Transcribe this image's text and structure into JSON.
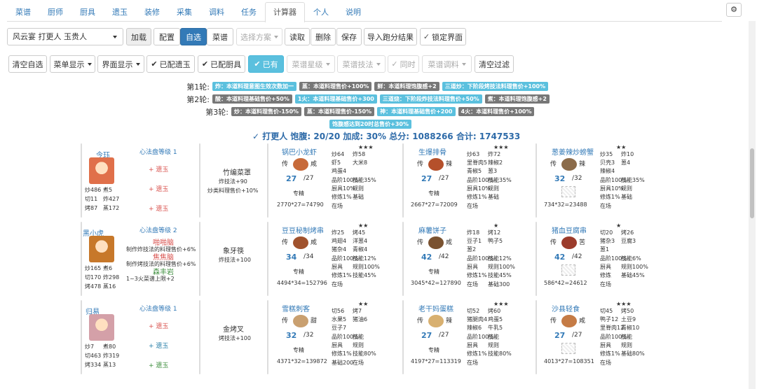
{
  "tabs": [
    "菜谱",
    "厨师",
    "厨具",
    "遗玉",
    "装修",
    "采集",
    "调料",
    "任务",
    "计算器",
    "个人",
    "说明"
  ],
  "toolbar1": {
    "select": "风云宴 打更人 玉贵人",
    "load": "加载",
    "config": "配置",
    "self": "自选",
    "recipe": "菜谱",
    "scheme": "选择方案",
    "read": "读取",
    "delete": "删除",
    "save": "保存",
    "import": "导入跑分结果",
    "lock": "锁定界面"
  },
  "toolbar2": {
    "clear_self": "清空自选",
    "menu_show": "菜单显示",
    "ui_show": "界面显示",
    "yiyu": "已配遗玉",
    "chuju": "已配厨具",
    "yiyou": "已有",
    "star": "菜谱星级",
    "skill": "菜谱技法",
    "same": "同时",
    "season": "菜谱调料",
    "clear_filter": "清空过滤"
  },
  "rounds": [
    {
      "label": "第1轮:",
      "badges": [
        {
          "text": "炸：本道料理意图生效次数加一",
          "c": "bi"
        },
        {
          "text": "蒸：本道料理售价+100%",
          "c": "bg"
        },
        {
          "text": "鲜：本道料理饱腹感+2",
          "c": "bg"
        },
        {
          "text": "三道炒：下阶段烤技法料理售价+100%",
          "c": "bi"
        }
      ]
    },
    {
      "label": "第2轮:",
      "badges": [
        {
          "text": "酸：本道料理基础售价+50%",
          "c": "bg"
        },
        {
          "text": "1火：本道料理基础售价+300",
          "c": "bi"
        },
        {
          "text": "三道烧：下阶段炸技法料理售价+50%",
          "c": "bi"
        },
        {
          "text": "煮：本道料理饱腹感+2",
          "c": "bg"
        }
      ]
    },
    {
      "label": "第3轮:",
      "badges": [
        {
          "text": "炒：本道料理售价-150%",
          "c": "bg"
        },
        {
          "text": "蒸：本道料理售价-150%",
          "c": "bg"
        },
        {
          "text": "神：本道料理基础售价+200",
          "c": "bi"
        },
        {
          "text": "4火：本道料理售价+100%",
          "c": "bg"
        }
      ]
    },
    {
      "label": "",
      "badges": [
        {
          "text": "饱腹感达到20时总售价+30%",
          "c": "bi"
        }
      ]
    }
  ],
  "summary": "✓ 打更人 饱腹: 20/20 加成: 30% 总分: 1088266 合计: 1747533",
  "chefs": [
    {
      "name": "今珏",
      "level": "心法盘等级 1",
      "stats": [
        "炒486",
        "煮5",
        "切11",
        "炸427",
        "烤87",
        "蒸172"
      ],
      "gems": [
        {
          "t": "+ 遗玉",
          "c": "red"
        },
        {
          "t": "+ 遗玉",
          "c": "red"
        },
        {
          "t": "+ 遗玉",
          "c": "red"
        }
      ],
      "avatar": "#e0704a",
      "tool": {
        "name": "竹编菜罩",
        "l1": "炸技法+90",
        "l2": "炒类料理售价+10%"
      },
      "dishes": [
        {
          "name": "锅巴小龙虾",
          "stars": "★★★",
          "q": "传",
          "cond": "咸",
          "cnt": "27",
          "max": "/27",
          "label": "专精",
          "calc": "2770*27=74790",
          "mat": [
            "炒64",
            "炸58",
            "虾5",
            "大米8",
            "鸡蛋4",
            ""
          ],
          "eff": [
            "品阶100%",
            "技能35%",
            "厨具10%",
            "规则",
            "修炼1%",
            "基础"
          ],
          "place": "在场",
          "img": "#c76a3a"
        },
        {
          "name": "生爆排骨",
          "stars": "★★★",
          "q": "传",
          "cond": "辣",
          "cnt": "27",
          "max": "/27",
          "label": "专精",
          "calc": "2667*27=72009",
          "mat": [
            "炒63",
            "炸72",
            "里脊肉5",
            "辣椒2",
            "青椒5",
            "葱3"
          ],
          "eff": [
            "品阶100%",
            "技能35%",
            "厨具10%",
            "规则",
            "修炼1%",
            "基础"
          ],
          "place": "在场",
          "img": "#b5502b"
        },
        {
          "name": "葱姜辣炒螃蟹",
          "stars": "★★",
          "q": "传",
          "cond": "辣",
          "cnt": "32",
          "max": "/32",
          "label": "",
          "calc": "734*32=23488",
          "mat": [
            "炒35",
            "炸10",
            "贝壳3",
            "葱4",
            "辣椒4",
            ""
          ],
          "eff": [
            "品阶100%",
            "技能35%",
            "厨具10%",
            "规则",
            "修炼1%",
            "基础"
          ],
          "place": "在场",
          "img": "#8b6b4a",
          "ph": true
        }
      ]
    },
    {
      "name": "黑小虎",
      "level": "心法盘等级 2",
      "stats": [
        "炒165",
        "煮6",
        "切170",
        "炸298",
        "烤478",
        "蒸16"
      ],
      "gems": [
        {
          "t": "啪啪脑",
          "c": "red",
          "sub": "制作炸技法的料理售价+6%"
        },
        {
          "t": "焦焦脑",
          "c": "red",
          "sub": "制作烤技法的料理售价+6%"
        },
        {
          "t": "森丰岩",
          "c": "green",
          "sub": "1~3火菜谱上限+2"
        }
      ],
      "avatar": "#c7782a",
      "tool": {
        "name": "象牙筷",
        "l1": "炸技法+100",
        "l2": ""
      },
      "dishes": [
        {
          "name": "豆豆秘制烤串",
          "stars": "★★",
          "q": "传",
          "cond": "咸",
          "cnt": "34",
          "max": "/34",
          "label": "专精",
          "calc": "4494*34=152796",
          "mat": [
            "炸25",
            "烤45",
            "鸡翅4",
            "洋葱4",
            "猪杂4",
            "青椒4"
          ],
          "eff": [
            "品阶100%",
            "技能12%",
            "厨具",
            "规则100%",
            "修炼1%",
            "技能45%"
          ],
          "place": "在场",
          "img": "#a0522d"
        },
        {
          "name": "麻薯饼子",
          "stars": "★",
          "q": "传",
          "cond": "咸",
          "cnt": "42",
          "max": "/42",
          "label": "专精",
          "calc": "3045*42=127890",
          "mat": [
            "炸18",
            "烤12",
            "豆子1",
            "鸭子5",
            "葱2",
            ""
          ],
          "eff": [
            "品阶100%",
            "技能12%",
            "厨具",
            "规则100%",
            "修炼1%",
            "技能45%"
          ],
          "place": "在场",
          "extra": "基础300",
          "img": "#7a5230"
        },
        {
          "name": "猪血豆腐串",
          "stars": "★",
          "q": "传",
          "cond": "苦",
          "cnt": "42",
          "max": "/42",
          "label": "",
          "calc": "586*42=24612",
          "mat": [
            "切20",
            "烤26",
            "猪杂3",
            "豆腐3",
            "葱1",
            ""
          ],
          "eff": [
            "品阶100%",
            "技能6%",
            "厨具",
            "规则100%",
            "修炼",
            "基础45%"
          ],
          "place": "在场",
          "img": "#9b3b2b",
          "ph": true
        }
      ]
    },
    {
      "name": "归易",
      "level": "心法盘等级 1",
      "stats": [
        "炒7",
        "煮80",
        "切463",
        "炸319",
        "烤334",
        "蒸13"
      ],
      "gems": [
        {
          "t": "+ 遗玉",
          "c": "red"
        },
        {
          "t": "+ 遗玉",
          "c": "teal"
        },
        {
          "t": "+ 遗玉",
          "c": "green"
        }
      ],
      "avatar": "#d4a0a8",
      "tool": {
        "name": "金烤叉",
        "l1": "烤技法+100",
        "l2": ""
      },
      "dishes": [
        {
          "name": "雪糕刺客",
          "stars": "★★",
          "q": "传",
          "cond": "甜",
          "cnt": "32",
          "max": "/32",
          "label": "专精",
          "calc": "4371*32=139872",
          "mat": [
            "切56",
            "烤7",
            "水果5",
            "猪油6",
            "豆子7",
            ""
          ],
          "eff": [
            "品阶100%",
            "技能",
            "厨具",
            "规则",
            "修炼1%",
            "技能80%"
          ],
          "place": "基础200",
          "extra": "在场",
          "img": "#c9a070"
        },
        {
          "name": "老干妈蛋糕",
          "stars": "★★★",
          "q": "传",
          "cond": "辣",
          "cnt": "27",
          "max": "/27",
          "label": "专精",
          "calc": "4197*27=113319",
          "mat": [
            "切52",
            "烤60",
            "猪腿肉4",
            "鸡蛋5",
            "辣椒6",
            "牛乳5"
          ],
          "eff": [
            "品阶100%",
            "技能",
            "厨具",
            "规则",
            "修炼1%",
            "技能80%"
          ],
          "place": "在场",
          "img": "#d8b070"
        },
        {
          "name": "沙县轻食",
          "stars": "★★★",
          "q": "传",
          "cond": "咸",
          "cnt": "27",
          "max": "/27",
          "label": "",
          "calc": "4013*27=108351",
          "mat": [
            "切45",
            "烤50",
            "鸭子12",
            "土豆9",
            "里脊肉12",
            "青椒10"
          ],
          "eff": [
            "品阶100%",
            "技能",
            "厨具",
            "规则",
            "修炼1%",
            "基础80%"
          ],
          "place": "在场",
          "img": "#c57b45",
          "ph": true
        }
      ]
    }
  ]
}
